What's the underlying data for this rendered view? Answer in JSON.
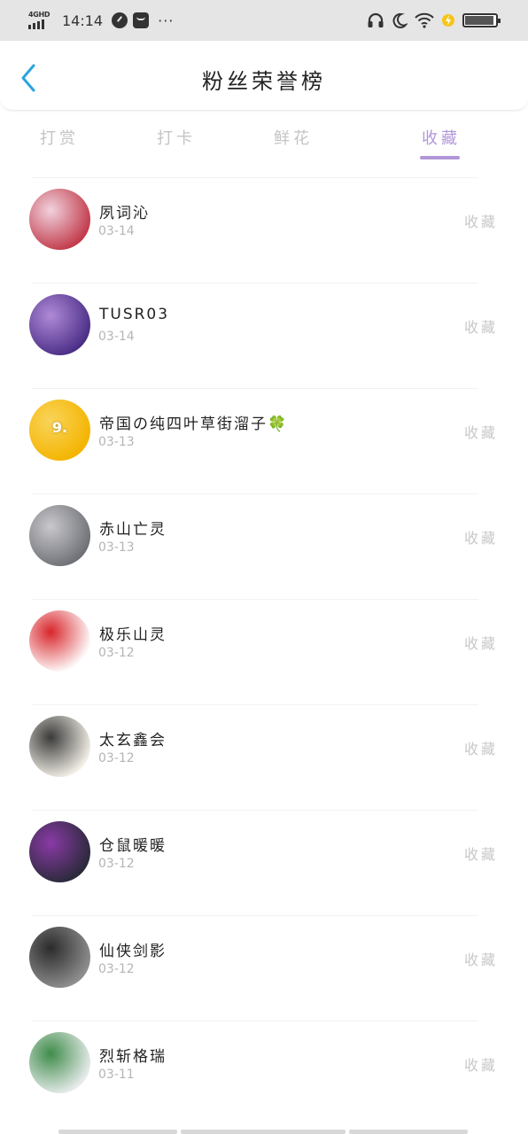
{
  "status_bar": {
    "network": "4GHD",
    "time": "14:14",
    "dots": "···",
    "battery_level": 0.88,
    "icons": [
      "signal-icon",
      "clock-icon",
      "message-icon",
      "headphones-icon",
      "moon-icon",
      "wifi-icon",
      "charging-icon",
      "battery-icon"
    ]
  },
  "header": {
    "title": "粉丝荣誉榜",
    "back_icon": "chevron-left-icon"
  },
  "tabs": [
    {
      "label": "打赏",
      "active": false
    },
    {
      "label": "打卡",
      "active": false
    },
    {
      "label": "鲜花",
      "active": false
    },
    {
      "label": "收藏",
      "active": true
    }
  ],
  "colors": {
    "accent": "#b197d8",
    "back_icon": "#2aa3e0",
    "inactive_text": "#c4c4c4",
    "date_text": "#b5b5b5"
  },
  "items": [
    {
      "name": "夙词沁",
      "date": "03-14",
      "action": "收藏",
      "avatar_colors": [
        "#c23a4a",
        "#f0d2dd"
      ]
    },
    {
      "name": "TUSR03",
      "date": "03-14",
      "action": "收藏",
      "avatar_colors": [
        "#4a2e86",
        "#b08ad8"
      ]
    },
    {
      "name": "帝国の纯四叶草街溜子🍀",
      "date": "03-13",
      "action": "收藏",
      "avatar_colors": [
        "#f4b400",
        "#f9d45a"
      ],
      "avatar_text": "9."
    },
    {
      "name": "赤山亡灵",
      "date": "03-13",
      "action": "收藏",
      "avatar_colors": [
        "#6f7076",
        "#c9c9cc"
      ]
    },
    {
      "name": "极乐山灵",
      "date": "03-12",
      "action": "收藏",
      "avatar_colors": [
        "#ffffff",
        "#d8262b"
      ]
    },
    {
      "name": "太玄鑫会",
      "date": "03-12",
      "action": "收藏",
      "avatar_colors": [
        "#f2efe6",
        "#3b3b3b"
      ]
    },
    {
      "name": "仓鼠暖暖",
      "date": "03-12",
      "action": "收藏",
      "avatar_colors": [
        "#2a2a3a",
        "#8a3aa6"
      ]
    },
    {
      "name": "仙侠剑影",
      "date": "03-12",
      "action": "收藏",
      "avatar_colors": [
        "#8f8f8f",
        "#2b2b2b"
      ]
    },
    {
      "name": "烈斩格瑞",
      "date": "03-11",
      "action": "收藏",
      "avatar_colors": [
        "#e8ecec",
        "#3f8c4a"
      ]
    }
  ]
}
